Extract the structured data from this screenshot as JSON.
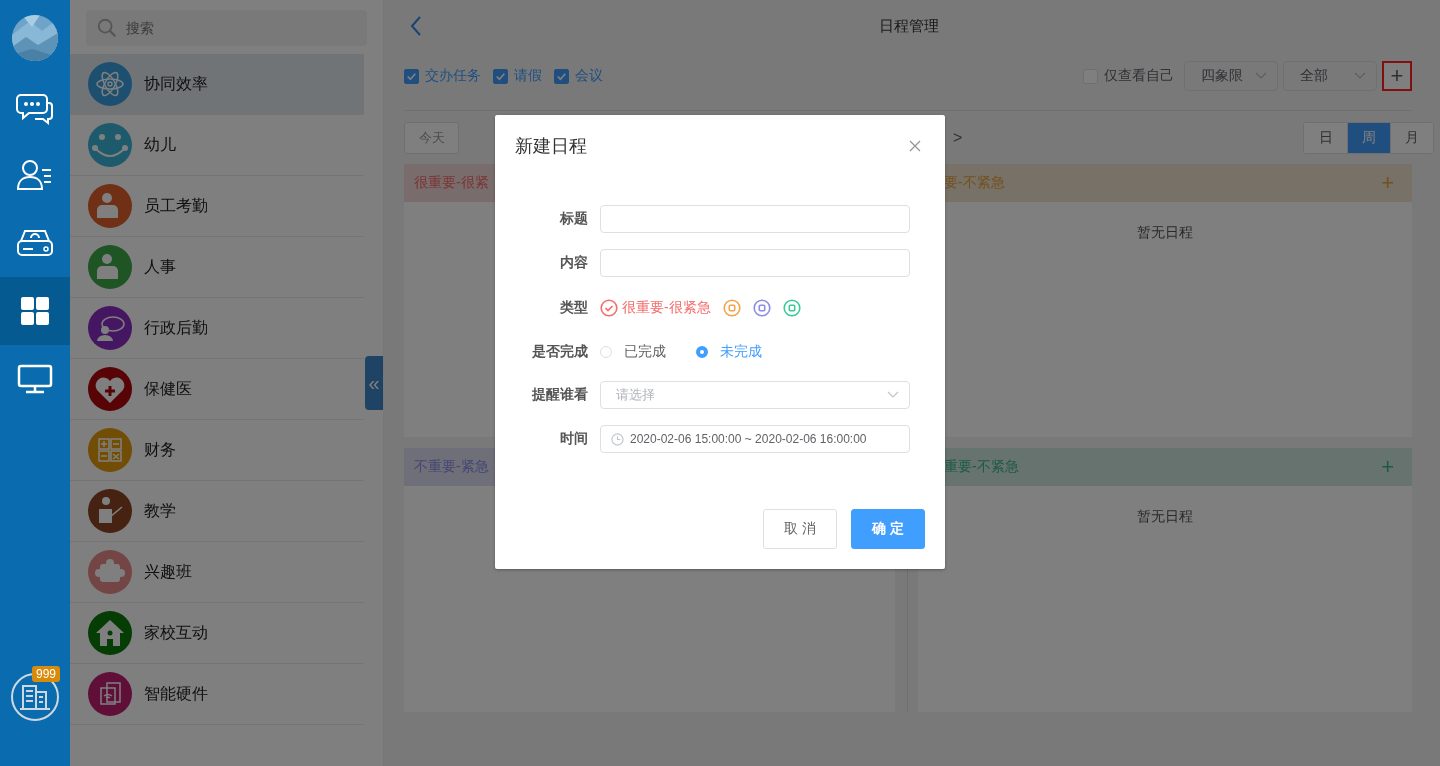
{
  "rail": {
    "badge": "999",
    "items": [
      {
        "selected": false
      },
      {
        "selected": false
      },
      {
        "selected": false
      },
      {
        "selected": true
      },
      {
        "selected": false
      }
    ]
  },
  "sidebar": {
    "search": {
      "placeholder": "搜索"
    },
    "items": [
      {
        "label": "协同效率",
        "selected": true
      },
      {
        "label": "幼儿",
        "selected": false
      },
      {
        "label": "员工考勤",
        "selected": false
      },
      {
        "label": "人事",
        "selected": false
      },
      {
        "label": "行政后勤",
        "selected": false
      },
      {
        "label": "保健医",
        "selected": false
      },
      {
        "label": "财务",
        "selected": false
      },
      {
        "label": "教学",
        "selected": false
      },
      {
        "label": "兴趣班",
        "selected": false
      },
      {
        "label": "家校互动",
        "selected": false
      },
      {
        "label": "智能硬件",
        "selected": false
      }
    ],
    "collapse": "«"
  },
  "header": {
    "title": "日程管理"
  },
  "filters": [
    {
      "label": "交办任务",
      "checked": true
    },
    {
      "label": "请假",
      "checked": true
    },
    {
      "label": "会议",
      "checked": true
    }
  ],
  "only_mine": {
    "label": "仅查看自己",
    "checked": false
  },
  "selects": [
    {
      "value": "四象限"
    },
    {
      "value": "全部"
    }
  ],
  "add_button": "+",
  "today_button": "今天",
  "next": ">",
  "views": [
    {
      "label": "日",
      "selected": false
    },
    {
      "label": "周",
      "selected": true
    },
    {
      "label": "月",
      "selected": false
    }
  ],
  "quadrants": [
    {
      "title": "很重要-很紧"
    },
    {
      "title": "要-不紧急",
      "add_button": "+",
      "empty": "暂无日程"
    },
    {
      "title": "不重要-紧急"
    },
    {
      "title": "重要-不紧急",
      "add_button": "+",
      "empty": "暂无日程"
    }
  ],
  "dialog": {
    "title": "新建日程",
    "fields": [
      {
        "kind": "input",
        "label": "标题"
      },
      {
        "kind": "input",
        "label": "内容"
      },
      {
        "kind": "type",
        "label": "类型",
        "options": [
          {
            "label": "很重要-很紧急",
            "color": "#f56c6c",
            "selected": true
          },
          {
            "color": "#f5a34a",
            "selected": false
          },
          {
            "color": "#8c8ce6",
            "selected": false
          },
          {
            "color": "#3ec99a",
            "selected": false
          }
        ]
      },
      {
        "kind": "radio",
        "label": "是否完成",
        "options": [
          {
            "label": "已完成",
            "selected": false
          },
          {
            "label": "未完成",
            "selected": true
          }
        ]
      },
      {
        "kind": "select",
        "label": "提醒谁看",
        "placeholder": "请选择"
      },
      {
        "kind": "time",
        "label": "时间",
        "value": "2020-02-06 15:00:00 ~ 2020-02-06 16:00:00"
      }
    ],
    "buttons": [
      {
        "label": "取 消",
        "kind": "default"
      },
      {
        "label": "确 定",
        "kind": "primary"
      }
    ]
  }
}
